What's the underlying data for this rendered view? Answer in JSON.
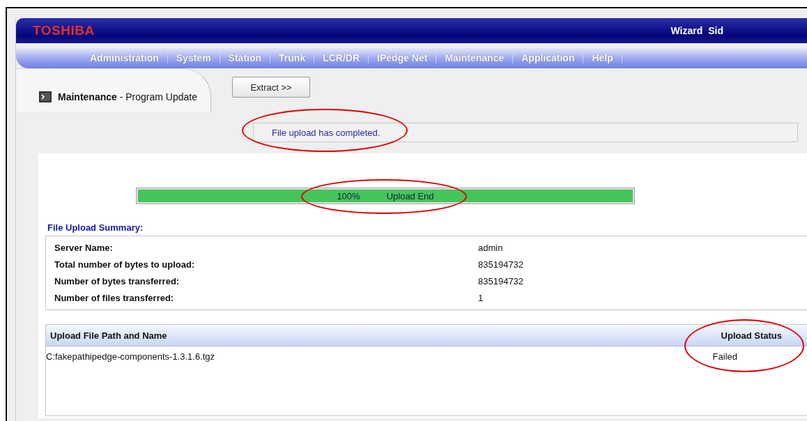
{
  "header": {
    "logo": "TOSHIBA",
    "user_label": "Wizard",
    "user_name": "Sid"
  },
  "nav": [
    {
      "label": "Administration"
    },
    {
      "label": "System"
    },
    {
      "label": "Station"
    },
    {
      "label": "Trunk"
    },
    {
      "label": "LCR/DR"
    },
    {
      "label": "IPedge Net"
    },
    {
      "label": "Maintenance"
    },
    {
      "label": "Application"
    },
    {
      "label": "Help"
    }
  ],
  "page_tab": {
    "title": "**Maintenance** - Program Update"
  },
  "extract_button": "Extract >>",
  "status_message": {
    "text": "File upload has completed.",
    "circled": true
  },
  "progress": {
    "level": 1,
    "percent": "100%",
    "label": "Upload End",
    "circled": true
  },
  "summary": {
    "title": "File Upload Summary:",
    "rows": [
      {
        "label": "Server Name:",
        "value": "admin"
      },
      {
        "label": "Total number of bytes to upload:",
        "value": "835194732"
      },
      {
        "label": "Number of bytes transferred:",
        "value": "835194732"
      },
      {
        "label": "Number of files transferred:",
        "value": "1"
      }
    ]
  },
  "files_table": {
    "columns": [
      "Upload File Path and Name",
      "Upload Status"
    ],
    "status_circled": true,
    "rows": [
      {
        "cells": [
          "C:fakepathipedge-components-1.3.1.6.tgz",
          "Failed"
        ]
      }
    ]
  }
}
